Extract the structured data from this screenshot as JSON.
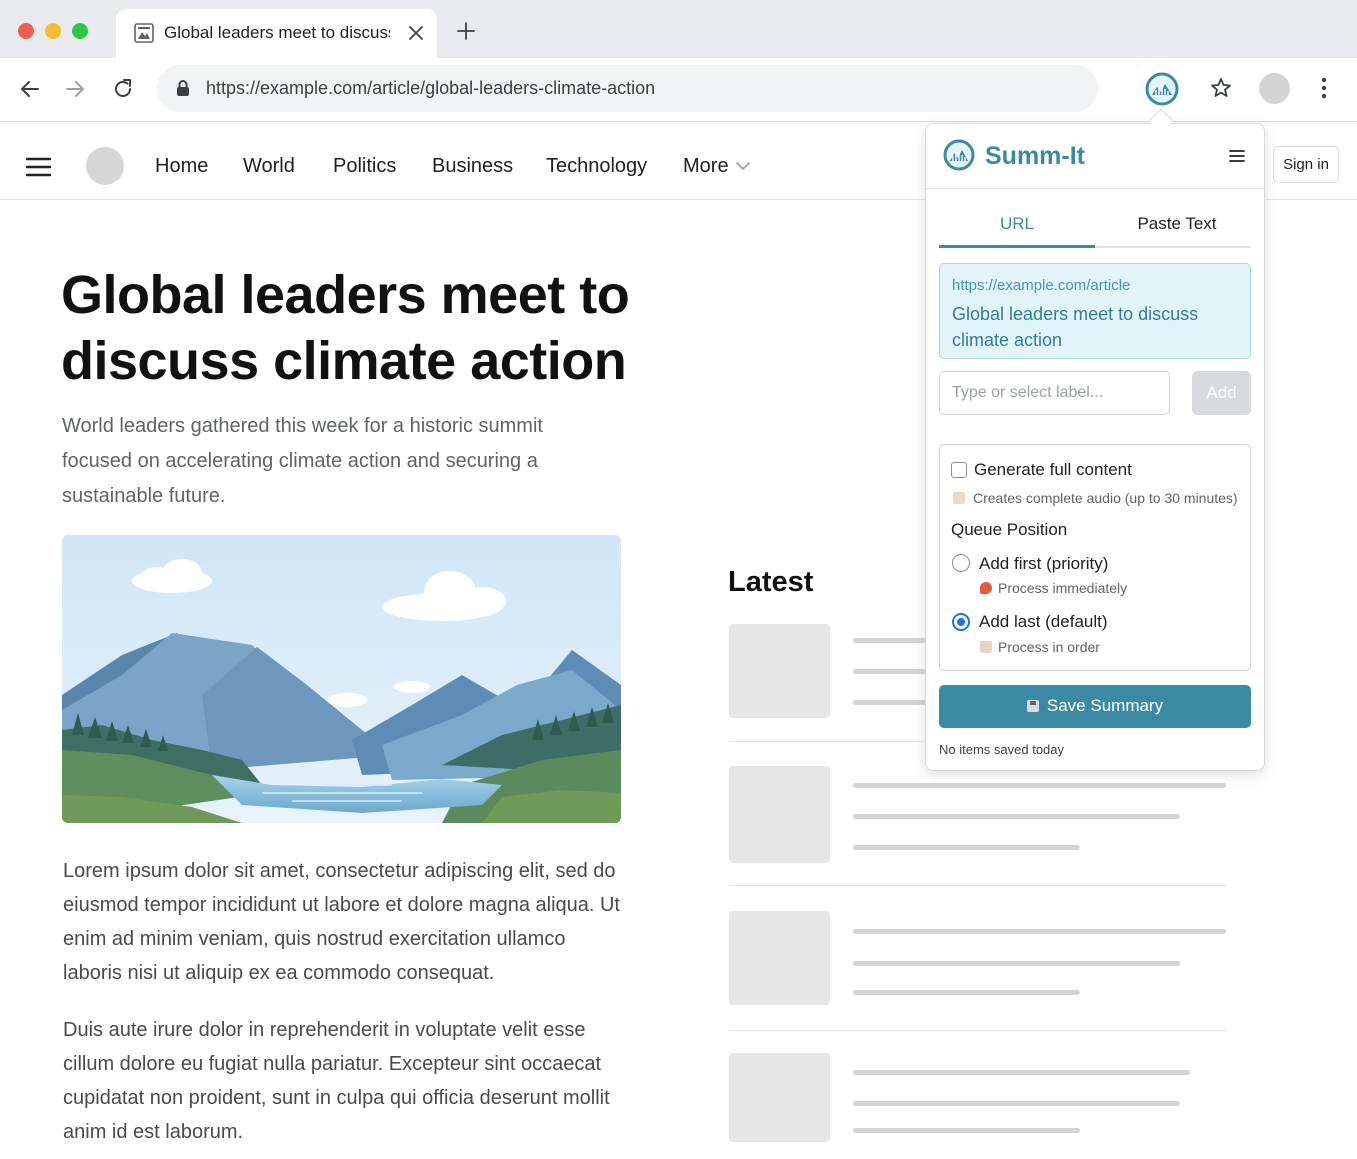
{
  "browser": {
    "tab_title": "Global leaders meet to discuss",
    "url": "https://example.com/article/global-leaders-climate-action"
  },
  "site": {
    "nav": [
      "Home",
      "World",
      "Politics",
      "Business",
      "Technology",
      "More"
    ],
    "sign_in": "Sign in"
  },
  "article": {
    "headline": "Global leaders meet to discuss climate action",
    "dek": "World leaders gathered this week for a historic summit focused on accelerating climate action and securing a sustainable future.",
    "paragraphs": [
      "Lorem ipsum dolor sit amet, consectetur adipiscing elit, sed do eiusmod tempor incididunt ut labore et dolore magna aliqua. Ut enim ad minim veniam, quis nostrud exercitation ullamco laboris nisi ut aliquip ex ea commodo consequat.",
      "Duis aute irure dolor in reprehenderit in voluptate velit esse cillum dolore eu fugiat nulla pariatur. Excepteur sint occaecat cupidatat non proident, sunt in culpa qui officia deserunt mollit anim id est laborum."
    ]
  },
  "latest": {
    "title": "Latest"
  },
  "extension": {
    "name": "Summ-It",
    "tabs": [
      "URL",
      "Paste Text"
    ],
    "active_tab": "URL",
    "url_card": {
      "link": "https://example.com/article",
      "title": "Global leaders meet to discuss climate action"
    },
    "label_input": {
      "placeholder": "Type or select label...",
      "value": ""
    },
    "add_button": "Add",
    "generate_full": {
      "label": "Generate full content",
      "hint": "Creates complete audio (up to 30 minutes)",
      "checked": false
    },
    "queue": {
      "title": "Queue Position",
      "options": [
        {
          "label": "Add first (priority)",
          "hint": "Process immediately",
          "selected": false
        },
        {
          "label": "Add last (default)",
          "hint": "Process in order",
          "selected": true
        }
      ]
    },
    "save_button": "Save Summary",
    "status": "No items saved today",
    "accent_color": "#3b8aa4"
  }
}
